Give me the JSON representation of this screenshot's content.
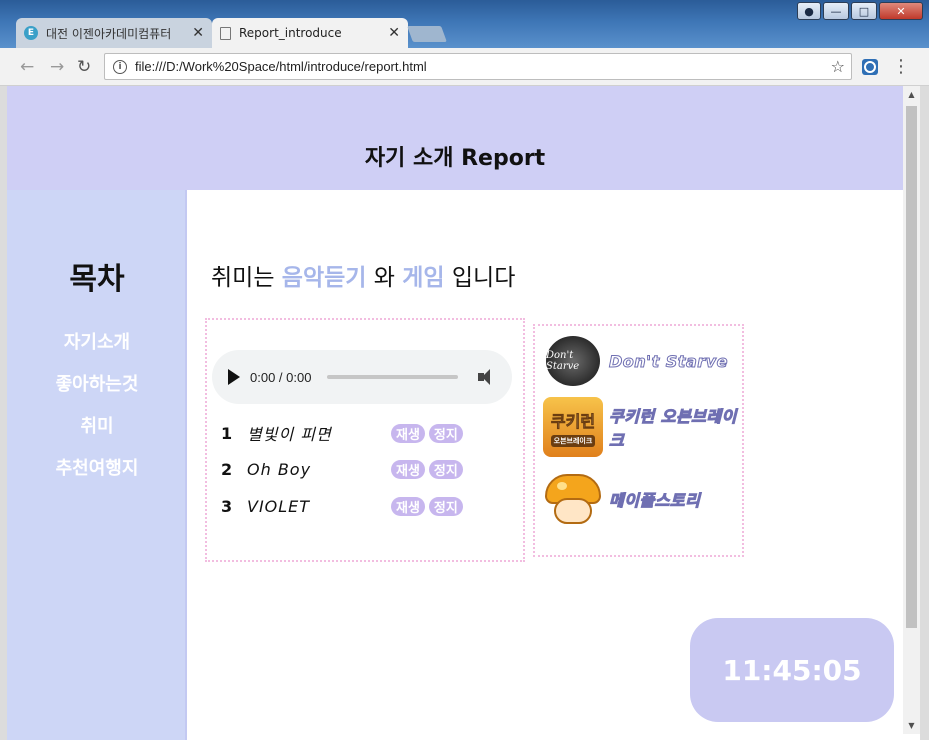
{
  "browser": {
    "tabs": [
      {
        "label": "대전 이젠아카데미컴퓨터",
        "favicon": "E",
        "active": false
      },
      {
        "label": "Report_introduce",
        "active": true
      }
    ],
    "url": "file:///D:/Work%20Space/html/introduce/report.html"
  },
  "page": {
    "header_title": "자기 소개 Report",
    "sidebar": {
      "title": "목차",
      "items": [
        "자기소개",
        "좋아하는것",
        "취미",
        "추천여행지"
      ]
    },
    "headline": {
      "prefix": "취미는 ",
      "hobby1": "음악듣기",
      "middle": " 와 ",
      "hobby2": "게임",
      "suffix": " 입니다"
    },
    "audio": {
      "time": "0:00 / 0:00",
      "progress": 0
    },
    "songs": [
      {
        "num": "1",
        "title": "별빛이 피면",
        "play": "재생",
        "stop": "정지"
      },
      {
        "num": "2",
        "title": "Oh Boy",
        "play": "재생",
        "stop": "정지"
      },
      {
        "num": "3",
        "title": "VIOLET",
        "play": "재생",
        "stop": "정지"
      }
    ],
    "games": [
      {
        "name": "Don't Starve",
        "logo_text": "Don't Starve",
        "icon": "dont-starve-icon"
      },
      {
        "name": "쿠키런 오븐브레이크",
        "logo_text": "쿠키런",
        "logo_sub": "오븐브레이크",
        "icon": "cookie-run-icon"
      },
      {
        "name": "메이플스토리",
        "icon": "maplestory-mushroom-icon"
      }
    ],
    "clock": "11:45:05"
  },
  "colors": {
    "header_bg": "#cfcff5",
    "sidebar_bg": "#cdd6f6",
    "highlight": "#a6b6ea",
    "button_bg": "#c7b6ee",
    "clock_bg": "#c9c9f2"
  }
}
